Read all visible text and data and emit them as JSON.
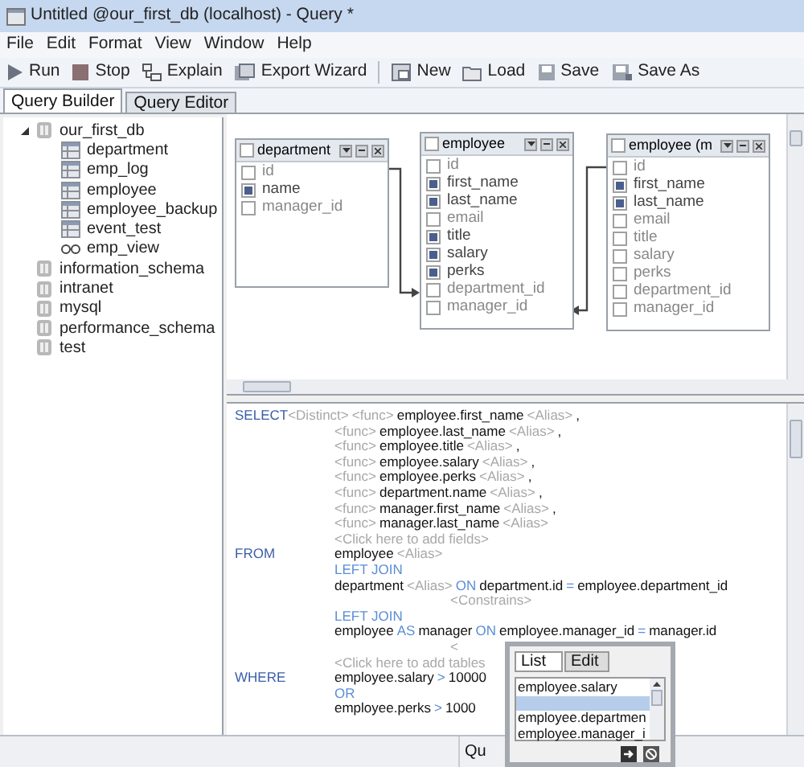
{
  "window": {
    "title": "Untitled @our_first_db (localhost) - Query *"
  },
  "menu": [
    "File",
    "Edit",
    "Format",
    "View",
    "Window",
    "Help"
  ],
  "toolbar": [
    {
      "kind": "run",
      "label": "Run"
    },
    {
      "kind": "stop",
      "label": "Stop"
    },
    {
      "kind": "explain",
      "label": "Explain"
    },
    {
      "kind": "export",
      "label": "Export Wizard"
    },
    {
      "kind": "separator"
    },
    {
      "kind": "new",
      "label": "New"
    },
    {
      "kind": "load",
      "label": "Load"
    },
    {
      "kind": "save",
      "label": "Save"
    },
    {
      "kind": "saveas",
      "label": "Save As"
    }
  ],
  "tabs": [
    {
      "label": "Query Builder",
      "selected": true
    },
    {
      "label": "Query Editor",
      "selected": false
    }
  ],
  "tree": [
    {
      "label": "our_first_db",
      "kind": "db",
      "expanded": true,
      "children": [
        {
          "label": "department",
          "kind": "table"
        },
        {
          "label": "emp_log",
          "kind": "table"
        },
        {
          "label": "employee",
          "kind": "table"
        },
        {
          "label": "employee_backup",
          "kind": "table"
        },
        {
          "label": "event_test",
          "kind": "table"
        },
        {
          "label": "emp_view",
          "kind": "view"
        }
      ]
    },
    {
      "label": "information_schema",
      "kind": "db"
    },
    {
      "label": "intranet",
      "kind": "db"
    },
    {
      "label": "mysql",
      "kind": "db"
    },
    {
      "label": "performance_schema",
      "kind": "db"
    },
    {
      "label": "test",
      "kind": "db"
    }
  ],
  "diagram_tables": [
    {
      "title": "department",
      "header_checked": false,
      "fields": [
        {
          "name": "id",
          "checked": false
        },
        {
          "name": "name",
          "checked": true
        },
        {
          "name": "manager_id",
          "checked": false
        }
      ]
    },
    {
      "title": "employee",
      "header_checked": false,
      "fields": [
        {
          "name": "id",
          "checked": false
        },
        {
          "name": "first_name",
          "checked": true
        },
        {
          "name": "last_name",
          "checked": true
        },
        {
          "name": "email",
          "checked": false
        },
        {
          "name": "title",
          "checked": true
        },
        {
          "name": "salary",
          "checked": true
        },
        {
          "name": "perks",
          "checked": true
        },
        {
          "name": "department_id",
          "checked": false
        },
        {
          "name": "manager_id",
          "checked": false
        }
      ]
    },
    {
      "title": "employee (m",
      "header_checked": false,
      "fields": [
        {
          "name": "id",
          "checked": false
        },
        {
          "name": "first_name",
          "checked": true
        },
        {
          "name": "last_name",
          "checked": true
        },
        {
          "name": "email",
          "checked": false
        },
        {
          "name": "title",
          "checked": false
        },
        {
          "name": "salary",
          "checked": false
        },
        {
          "name": "perks",
          "checked": false
        },
        {
          "name": "department_id",
          "checked": false
        },
        {
          "name": "manager_id",
          "checked": false
        }
      ]
    }
  ],
  "sql_lines": [
    {
      "keyword": "SELECT",
      "segments": [
        {
          "kind": "hint",
          "text": "<Distinct>"
        }
      ],
      "body": [
        {
          "kind": "hint",
          "text": "<func>"
        },
        {
          "kind": "field",
          "text": "employee.first_name"
        },
        {
          "kind": "hint",
          "text": "<Alias>"
        },
        {
          "kind": "field",
          "text": ","
        }
      ]
    },
    {
      "body": [
        {
          "kind": "hint",
          "text": "<func>"
        },
        {
          "kind": "field",
          "text": "employee.last_name"
        },
        {
          "kind": "hint",
          "text": "<Alias>"
        },
        {
          "kind": "field",
          "text": ","
        }
      ]
    },
    {
      "body": [
        {
          "kind": "hint",
          "text": "<func>"
        },
        {
          "kind": "field",
          "text": "employee.title"
        },
        {
          "kind": "hint",
          "text": "<Alias>"
        },
        {
          "kind": "field",
          "text": ","
        }
      ]
    },
    {
      "body": [
        {
          "kind": "hint",
          "text": "<func>"
        },
        {
          "kind": "field",
          "text": "employee.salary"
        },
        {
          "kind": "hint",
          "text": "<Alias>"
        },
        {
          "kind": "field",
          "text": ","
        }
      ]
    },
    {
      "body": [
        {
          "kind": "hint",
          "text": "<func>"
        },
        {
          "kind": "field",
          "text": "employee.perks"
        },
        {
          "kind": "hint",
          "text": "<Alias>"
        },
        {
          "kind": "field",
          "text": ","
        }
      ]
    },
    {
      "body": [
        {
          "kind": "hint",
          "text": "<func>"
        },
        {
          "kind": "field",
          "text": "department.name"
        },
        {
          "kind": "hint",
          "text": "<Alias>"
        },
        {
          "kind": "field",
          "text": ","
        }
      ]
    },
    {
      "body": [
        {
          "kind": "hint",
          "text": "<func>"
        },
        {
          "kind": "field",
          "text": "manager.first_name"
        },
        {
          "kind": "hint",
          "text": "<Alias>"
        },
        {
          "kind": "field",
          "text": ","
        }
      ]
    },
    {
      "body": [
        {
          "kind": "hint",
          "text": "<func>"
        },
        {
          "kind": "field",
          "text": "manager.last_name"
        },
        {
          "kind": "hint",
          "text": "<Alias>"
        }
      ]
    },
    {
      "body": [
        {
          "kind": "hint",
          "text": "<Click here to add fields>"
        }
      ]
    },
    {
      "keyword": "FROM",
      "body": [
        {
          "kind": "field",
          "text": "employee"
        },
        {
          "kind": "hint",
          "text": "<Alias>"
        }
      ]
    },
    {
      "body": [
        {
          "kind": "kw",
          "text": "LEFT JOIN"
        }
      ]
    },
    {
      "body": [
        {
          "kind": "field",
          "text": "department"
        },
        {
          "kind": "hint",
          "text": "<Alias>"
        },
        {
          "kind": "kw",
          "text": "ON"
        },
        {
          "kind": "field",
          "text": "department.id"
        },
        {
          "kind": "kw",
          "text": "="
        },
        {
          "kind": "field",
          "text": "employee.department_id"
        }
      ]
    },
    {
      "indent": true,
      "body": [
        {
          "kind": "hint",
          "text": "<Constrains>"
        }
      ]
    },
    {
      "body": [
        {
          "kind": "kw",
          "text": "LEFT JOIN"
        }
      ]
    },
    {
      "body": [
        {
          "kind": "field",
          "text": "employee"
        },
        {
          "kind": "kw",
          "text": "AS"
        },
        {
          "kind": "field",
          "text": "manager"
        },
        {
          "kind": "kw",
          "text": "ON"
        },
        {
          "kind": "field",
          "text": "employee.manager_id"
        },
        {
          "kind": "kw",
          "text": "="
        },
        {
          "kind": "field",
          "text": "manager.id"
        }
      ]
    },
    {
      "indent": true,
      "body": [
        {
          "kind": "hint",
          "text": "<"
        }
      ]
    },
    {
      "body": [
        {
          "kind": "hint",
          "text": "<Click here to add tables"
        }
      ]
    },
    {
      "keyword": "WHERE",
      "body": [
        {
          "kind": "field",
          "text": "employee.salary"
        },
        {
          "kind": "kw",
          "text": ">"
        },
        {
          "kind": "field",
          "text": "10000"
        }
      ]
    },
    {
      "body": [
        {
          "kind": "kw",
          "text": "OR"
        }
      ]
    },
    {
      "body": [
        {
          "kind": "field",
          "text": "employee.perks"
        },
        {
          "kind": "kw",
          "text": ">"
        },
        {
          "kind": "field",
          "text": "1000"
        }
      ]
    }
  ],
  "status_bar": {
    "text": "Qu"
  },
  "popup": {
    "tabs": [
      {
        "label": "List",
        "selected": true
      },
      {
        "label": "Edit",
        "selected": false
      }
    ],
    "items": [
      {
        "text": "employee.salary",
        "selected": false
      },
      {
        "selected": true
      },
      {
        "text": "employee.departmen",
        "selected": false
      },
      {
        "text": "employee.manager_i",
        "selected": false
      }
    ]
  }
}
